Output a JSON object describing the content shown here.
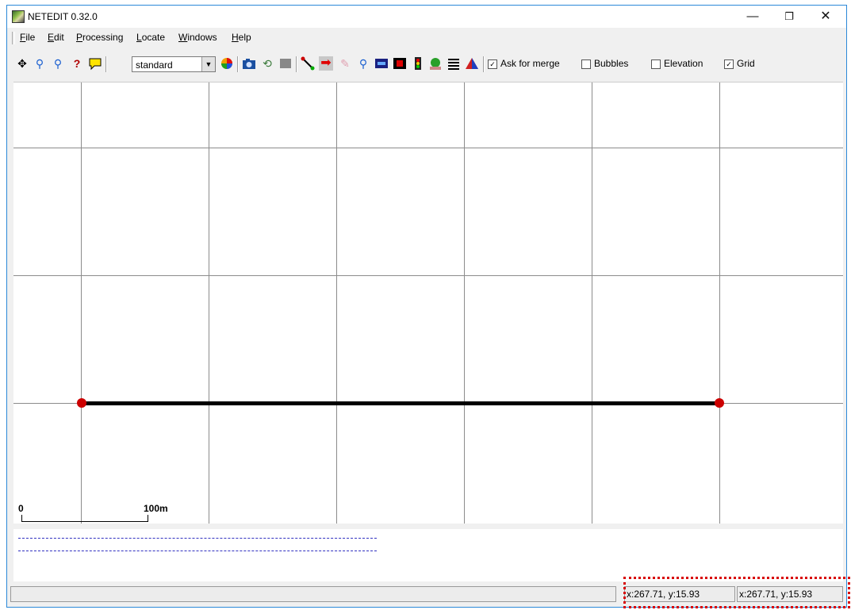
{
  "window": {
    "title": "NETEDIT 0.32.0"
  },
  "window_controls": {
    "minimize": "—",
    "maximize": "❐",
    "close": "✕"
  },
  "menu": [
    "File",
    "Edit",
    "Processing",
    "Locate",
    "Windows",
    "Help"
  ],
  "toolbar": {
    "view_scheme": "standard",
    "checkboxes": [
      {
        "label": "Ask for merge",
        "checked": true
      },
      {
        "label": "Bubbles",
        "checked": false
      },
      {
        "label": "Elevation",
        "checked": false
      },
      {
        "label": "Grid",
        "checked": true
      }
    ],
    "icons": [
      "recenter-view-icon",
      "zoom-icon",
      "locate-junction-icon",
      "edit-breakpoints-icon",
      "show-tooltips-icon",
      "color-wheel-icon",
      "screenshot-icon",
      "undo-icon",
      "redo-icon",
      "create-edge-icon",
      "move-icon",
      "delete-icon",
      "inspect-icon",
      "select-icon",
      "connection-icon",
      "traffic-light-icon",
      "additional-icon",
      "crossing-icon",
      "shapes-icon"
    ]
  },
  "canvas": {
    "scale_start": "0",
    "scale_end": "100m"
  },
  "status": {
    "coord_left": "x:267.71, y:15.93",
    "coord_right": "x:267.71, y:15.93"
  },
  "colors": {
    "edge": "#000000",
    "junction": "#cc0000",
    "grid": "#8c8c8c",
    "annotation_highlight": "#d80000"
  }
}
